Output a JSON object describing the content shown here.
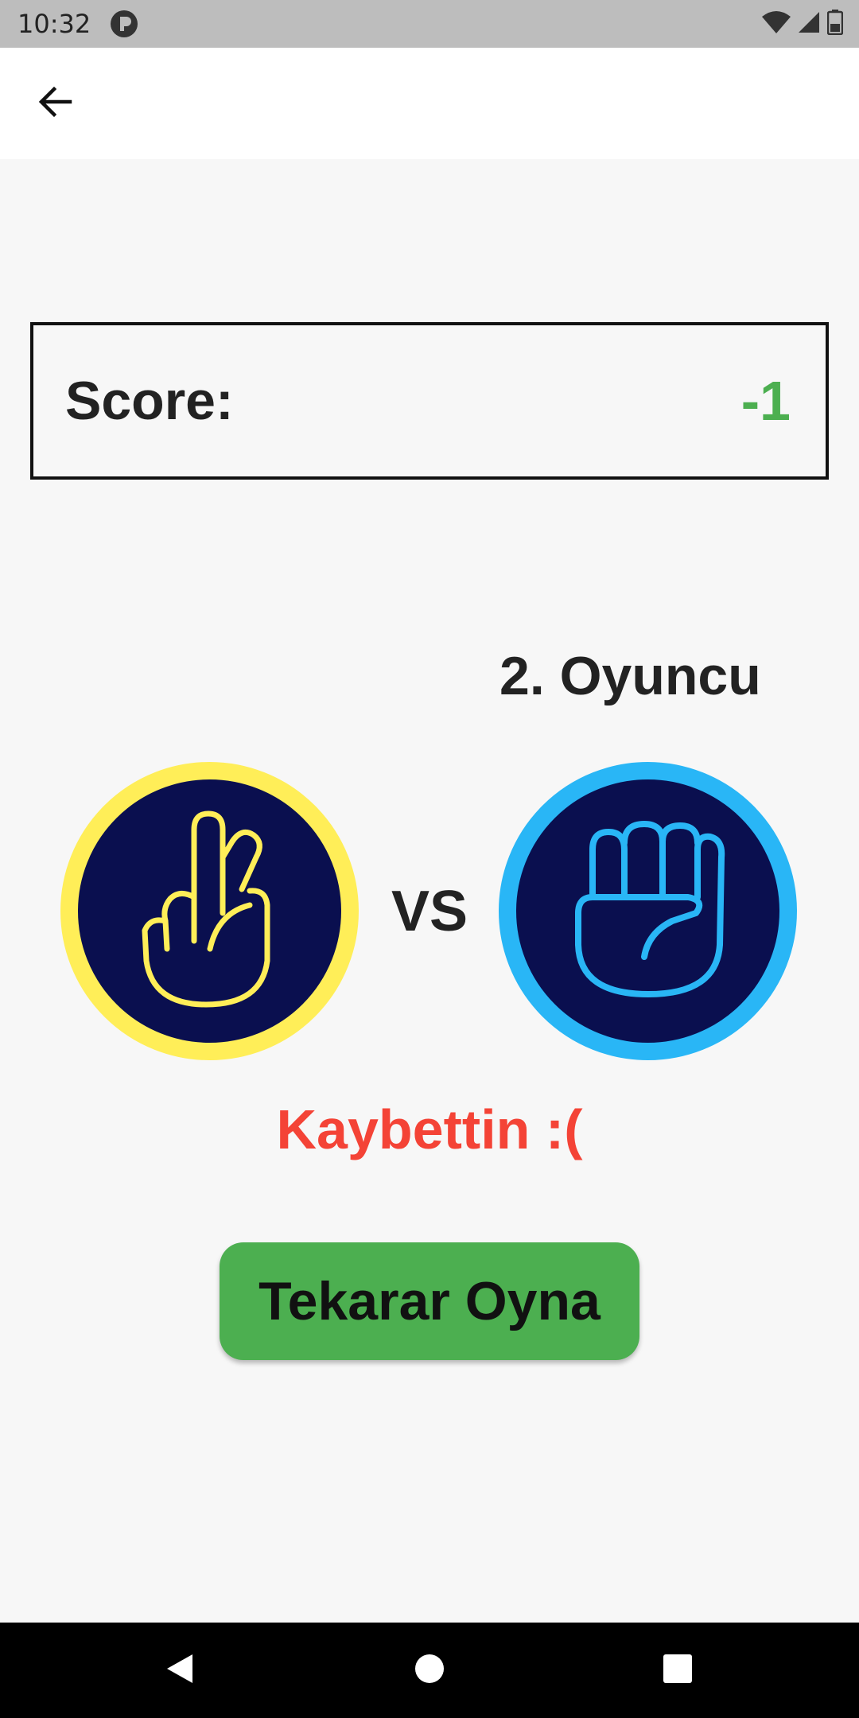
{
  "status_bar": {
    "time": "10:32"
  },
  "app_bar": {
    "back_icon": "arrow-left-icon"
  },
  "score": {
    "label": "Score:",
    "value": "-1",
    "value_color": "#4caf50"
  },
  "opponent": {
    "label": "2. Oyuncu"
  },
  "match": {
    "player_choice_icon": "two-fingers-hand-icon",
    "player_ring_color": "#ffee58",
    "vs_label": "VS",
    "opponent_choice_icon": "fist-hand-icon",
    "opponent_ring_color": "#29b6f6",
    "circle_fill": "#0a0f4f"
  },
  "result": {
    "text": "Kaybettin :(",
    "color": "#f44336"
  },
  "actions": {
    "replay_label": "Tekarar Oyna",
    "replay_color": "#4caf50"
  },
  "nav_bar": {
    "back_icon": "triangle-back-icon",
    "home_icon": "circle-home-icon",
    "recents_icon": "square-recents-icon"
  }
}
